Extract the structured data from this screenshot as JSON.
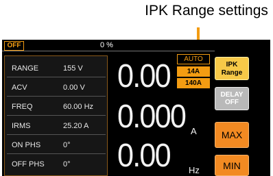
{
  "callout": {
    "text": "IPK Range settings"
  },
  "status": {
    "output_state": "OFF",
    "load_percent": "0 %"
  },
  "params": [
    {
      "label": "RANGE",
      "value": "155 V"
    },
    {
      "label": "ACV",
      "value": "0.00 V"
    },
    {
      "label": "FREQ",
      "value": "60.00 Hz"
    },
    {
      "label": "IRMS",
      "value": "25.20 A"
    },
    {
      "label": "ON PHS",
      "value": "0°"
    },
    {
      "label": "OFF PHS",
      "value": "0°"
    }
  ],
  "meters": {
    "voltage": {
      "value": "0.00",
      "unit": ""
    },
    "current": {
      "value": "0.000",
      "unit": "A"
    },
    "frequency": {
      "value": "0.00",
      "unit": "Hz"
    }
  },
  "ipk_menu": {
    "auto": "AUTO",
    "options": [
      "14A",
      "140A"
    ]
  },
  "softkeys": {
    "ipk_range": [
      "IPK",
      "Range"
    ],
    "delay_off": [
      "DELAY",
      "OFF"
    ],
    "max": "MAX",
    "min": "MIN"
  },
  "colors": {
    "accent": "#f39c12",
    "softkey_yellow": "#f7c948",
    "softkey_orange": "#f28a22",
    "softkey_gray": "#b9b9b9"
  }
}
